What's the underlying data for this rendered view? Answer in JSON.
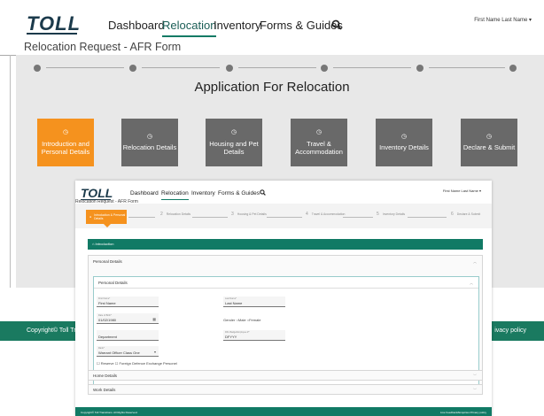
{
  "background": {
    "logo": "TOLL",
    "nav": [
      "Dashboard",
      "Relocation",
      "Inventory",
      "Forms & Guides"
    ],
    "user_menu": "First Name Last Name ▾",
    "page_title": "Relocation Request - AFR Form",
    "heading": "Application For Relocation",
    "step_cards": [
      {
        "label": "Introduction and Personal Details",
        "active": true
      },
      {
        "label": "Relocation Details",
        "active": false
      },
      {
        "label": "Housing and Pet Details",
        "active": false
      },
      {
        "label": "Travel & Accommodation",
        "active": false
      },
      {
        "label": "Inventory Details",
        "active": false
      },
      {
        "label": "Declare & Submit",
        "active": false
      }
    ],
    "footer_left": "Copyright© Toll Tra",
    "footer_right": "ivacy policy"
  },
  "inset": {
    "logo": "TOLL",
    "nav": [
      "Dashboard",
      "Relocation",
      "Inventory",
      "Forms & Guides"
    ],
    "user_menu": "First Name Last Name ▾",
    "page_title": "Relocation Request - AFR Form",
    "steps": [
      {
        "num": "",
        "label": "Introduction & Personal Details",
        "active": true
      },
      {
        "num": "2",
        "label": "Relocation Details"
      },
      {
        "num": "3",
        "label": "Housing & Pet Details"
      },
      {
        "num": "4",
        "label": "Travel & Accommodation"
      },
      {
        "num": "5",
        "label": "Inventory Details"
      },
      {
        "num": "6",
        "label": "Declare & Submit"
      }
    ],
    "intro_bar": "Introduction",
    "sections": {
      "personal": "Personal Details",
      "personal_inner": "Personal Details",
      "home": "Home Details",
      "work": "Work Details"
    },
    "fields": {
      "first_name": {
        "label": "First Name*",
        "value": "First Name"
      },
      "last_name": {
        "label": "Last Name*",
        "value": "Last Name"
      },
      "dob": {
        "label": "Date of Birth*",
        "value": "01/02/1980"
      },
      "department": {
        "label": "",
        "value": "Department"
      },
      "employee_id": {
        "label": "DFL Badge/Employee #*",
        "value": "DFYYY"
      },
      "rank": {
        "label": "Rank*",
        "value": "Warrant Officer Class One"
      }
    },
    "gender": {
      "label": "Gender",
      "male": "Male",
      "female": "Female"
    },
    "checkboxes": [
      "Reserve",
      "Foreign Defence Exchange Personel"
    ],
    "footer_left": "Copyright© Toll Transitions. All Rights Reserved.",
    "footer_right": "Live Feedback/Enquiries   Privacy policy"
  }
}
